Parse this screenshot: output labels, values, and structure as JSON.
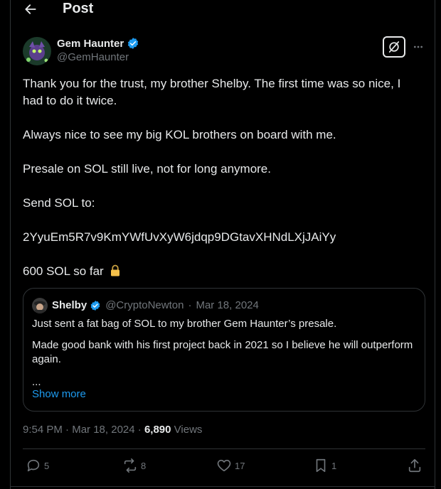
{
  "header": {
    "title": "Post"
  },
  "author": {
    "name": "Gem Haunter",
    "handle": "@GemHaunter",
    "verified": true
  },
  "tweet": {
    "paragraphs": [
      "Thank you for the trust, my brother Shelby. The first time was so nice, I had to do it twice.",
      "Always nice to see my big KOL brothers on board with me.",
      "Presale on SOL still live, not for long anymore.",
      "Send SOL to:",
      "2YyuEm5R7v9KmYWfUvXyW6jdqp9DGtavXHNdLXjJAiYy",
      "600 SOL so far"
    ],
    "emoji_icon": "lock-icon"
  },
  "quote": {
    "name": "Shelby",
    "handle": "@CryptoNewton",
    "separator": "·",
    "date": "Mar 18, 2024",
    "paragraphs": [
      "Just sent a fat bag of SOL to my brother Gem Haunter’s presale.",
      "Made good bank with his first project back in 2021 so I believe he will outperform again."
    ],
    "ellipsis": "...",
    "show_more": "Show more"
  },
  "meta": {
    "time": "9:54 PM",
    "dot": "·",
    "date": "Mar 18, 2024",
    "views_count": "6,890",
    "views_label": "Views"
  },
  "actions": {
    "replies": "5",
    "reposts": "8",
    "likes": "17",
    "bookmarks": "1"
  },
  "colors": {
    "background": "#000000",
    "text": "#e7e9ea",
    "muted": "#71767b",
    "accent": "#1d9bf0",
    "border": "#2f3336",
    "lock": "#f5c04a"
  }
}
